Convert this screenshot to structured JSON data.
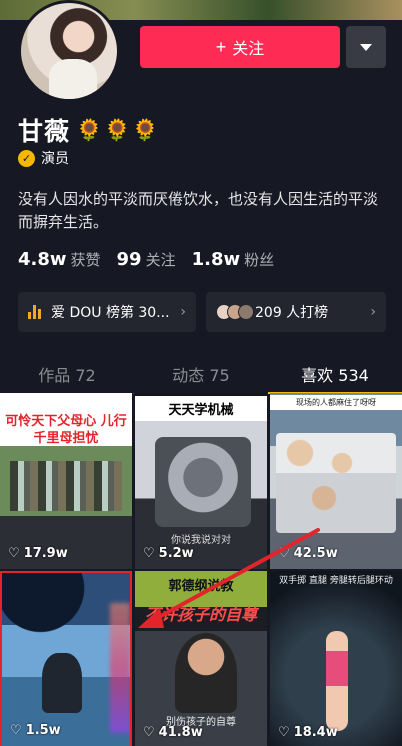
{
  "profile": {
    "name": "甘薇",
    "flowers": "🌻🌻🌻",
    "certification": "演员",
    "bio": "没有人因水的平淡而厌倦饮水，也没有人因生活的平淡而摒弃生活。"
  },
  "actions": {
    "follow_label": "关注"
  },
  "stats": [
    {
      "value": "4.8w",
      "label": "获赞"
    },
    {
      "value": "99",
      "label": "关注"
    },
    {
      "value": "1.8w",
      "label": "粉丝"
    }
  ],
  "cards": {
    "rank_text": "爱 DOU 榜第 30...",
    "hit_text": "209 人打榜"
  },
  "tabs": [
    {
      "label": "作品 72"
    },
    {
      "label": "动态 75"
    },
    {
      "label": "喜欢 534"
    }
  ],
  "videos": [
    {
      "caption": "可怜天下父母心 儿行千里母担忧",
      "likes": "17.9w"
    },
    {
      "caption": "天天学机械",
      "subtitle": "你说我说对对",
      "likes": "5.2w"
    },
    {
      "caption": "现场的人都麻住了呀呀",
      "likes": "42.5w"
    },
    {
      "caption": "",
      "likes": "1.5w"
    },
    {
      "caption": "郭德纲说教",
      "overlay": "不许孩子的自尊",
      "subtitle": "别伤孩子的自尊",
      "likes": "41.8w"
    },
    {
      "caption": "双手掷 直腿 旁腿转后腿环动",
      "likes": "18.4w"
    }
  ],
  "colors": {
    "accent": "#fe2c55",
    "tab_underline": "#f5b800",
    "highlight_border": "#e3242b"
  }
}
